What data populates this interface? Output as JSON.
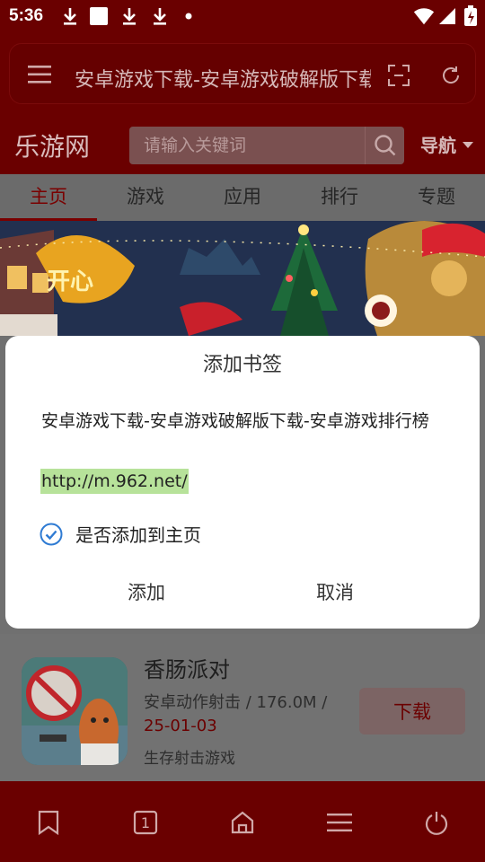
{
  "status_bar": {
    "time": "5:36",
    "icons": [
      "download-icon",
      "notification-square-icon",
      "download-icon",
      "download-icon",
      "dot-icon",
      "wifi-icon",
      "signal-icon",
      "battery-charging-icon"
    ]
  },
  "browser": {
    "url_title": "安卓游戏下载-安卓游戏破解版下载-安卓游戏排行"
  },
  "site": {
    "logo": "乐游网",
    "search_placeholder": "请输入关键词",
    "nav_label": "导航"
  },
  "tabs": [
    {
      "label": "主页",
      "active": true
    },
    {
      "label": "游戏",
      "active": false
    },
    {
      "label": "应用",
      "active": false
    },
    {
      "label": "排行",
      "active": false
    },
    {
      "label": "专题",
      "active": false
    }
  ],
  "game": {
    "title": "香肠派对",
    "meta": "安卓动作射击 / 176.0M /",
    "date": "25-01-03",
    "desc": "生存射击游戏",
    "download_label": "下载"
  },
  "dialog": {
    "title": "添加书签",
    "name": "安卓游戏下载-安卓游戏破解版下载-安卓游戏排行榜",
    "url": "http://m.962.net/",
    "checkbox_label": "是否添加到主页",
    "checked": true,
    "add_label": "添加",
    "cancel_label": "取消"
  },
  "bottom_nav": {
    "tab_count": "1",
    "icons": [
      "bookmark-icon",
      "tabs-icon",
      "home-icon",
      "menu-icon",
      "power-icon"
    ]
  },
  "colors": {
    "dark_red": "#6a0000",
    "accent_red": "#7a0000",
    "checkbox_blue": "#2f7bd3",
    "url_highlight": "#b7e29a"
  }
}
